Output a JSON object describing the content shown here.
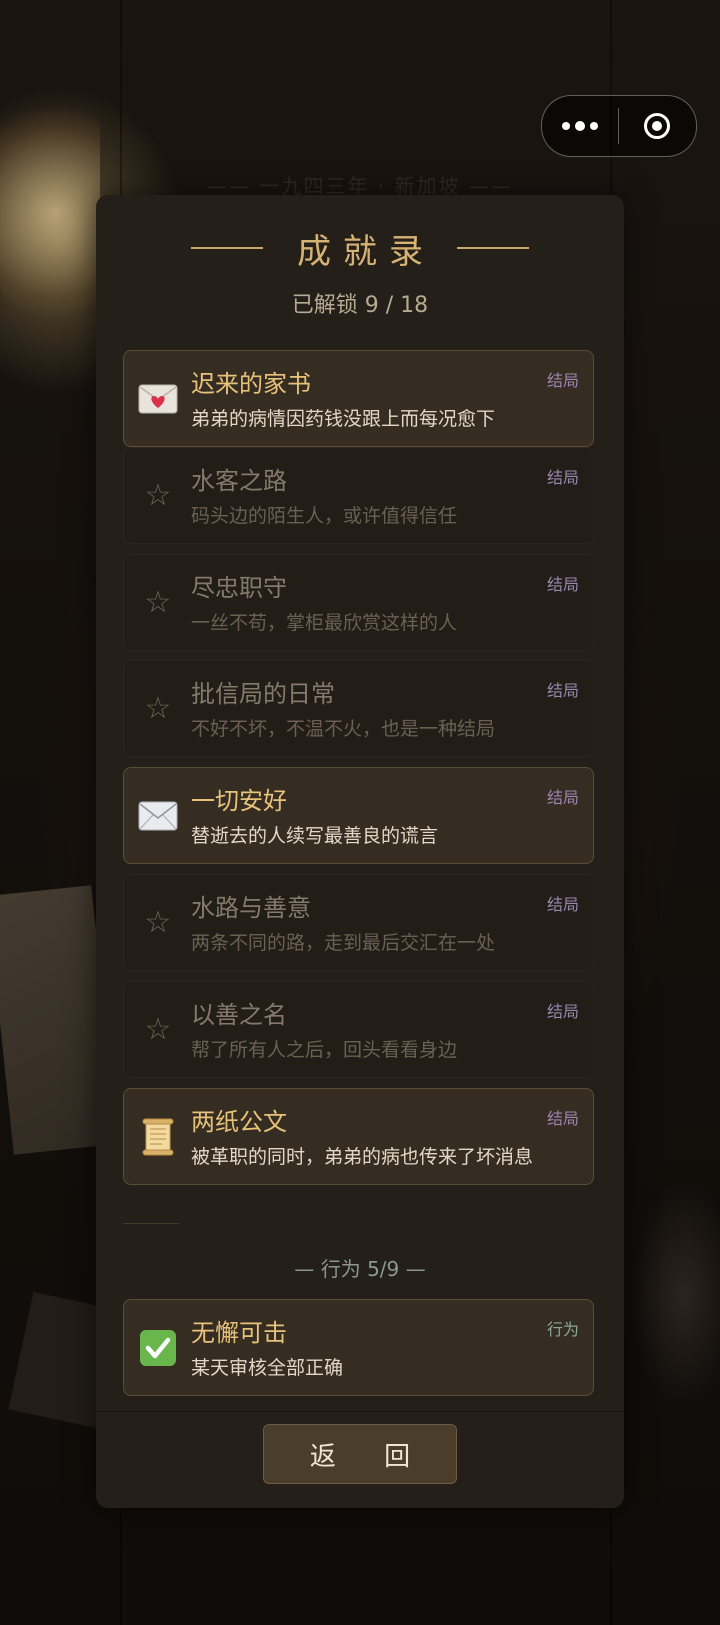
{
  "background": {
    "faded_title": "—— 一九四三年 · 新加坡 ——"
  },
  "capsule": {
    "more_icon": "more-dots-icon",
    "close_icon": "target-close-icon"
  },
  "modal": {
    "title": "成就录",
    "unlocked_summary": "已解锁 9 / 18",
    "ending_items": [
      {
        "name": "迟来的家书",
        "desc": "弟弟的病情因药钱没跟上而每况愈下",
        "tag": "结局",
        "unlocked": true,
        "icon": "love-letter-icon"
      },
      {
        "name": "水客之路",
        "desc": "码头边的陌生人，或许值得信任",
        "tag": "结局",
        "unlocked": false,
        "icon": "star-outline-icon"
      },
      {
        "name": "尽忠职守",
        "desc": "一丝不苟，掌柜最欣赏这样的人",
        "tag": "结局",
        "unlocked": false,
        "icon": "star-outline-icon"
      },
      {
        "name": "批信局的日常",
        "desc": "不好不坏，不温不火，也是一种结局",
        "tag": "结局",
        "unlocked": false,
        "icon": "star-outline-icon"
      },
      {
        "name": "一切安好",
        "desc": "替逝去的人续写最善良的谎言",
        "tag": "结局",
        "unlocked": true,
        "icon": "envelope-icon"
      },
      {
        "name": "水路与善意",
        "desc": "两条不同的路，走到最后交汇在一处",
        "tag": "结局",
        "unlocked": false,
        "icon": "star-outline-icon"
      },
      {
        "name": "以善之名",
        "desc": "帮了所有人之后，回头看看身边",
        "tag": "结局",
        "unlocked": false,
        "icon": "star-outline-icon"
      },
      {
        "name": "两纸公文",
        "desc": "被革职的同时，弟弟的病也传来了坏消息",
        "tag": "结局",
        "unlocked": true,
        "icon": "scroll-icon"
      }
    ],
    "behavior_section_title": "— 行为 5/9 —",
    "behavior_items": [
      {
        "name": "无懈可击",
        "desc": "某天审核全部正确",
        "tag": "行为",
        "unlocked": true,
        "icon": "check-mark-icon"
      }
    ],
    "back_button": "返 回"
  }
}
